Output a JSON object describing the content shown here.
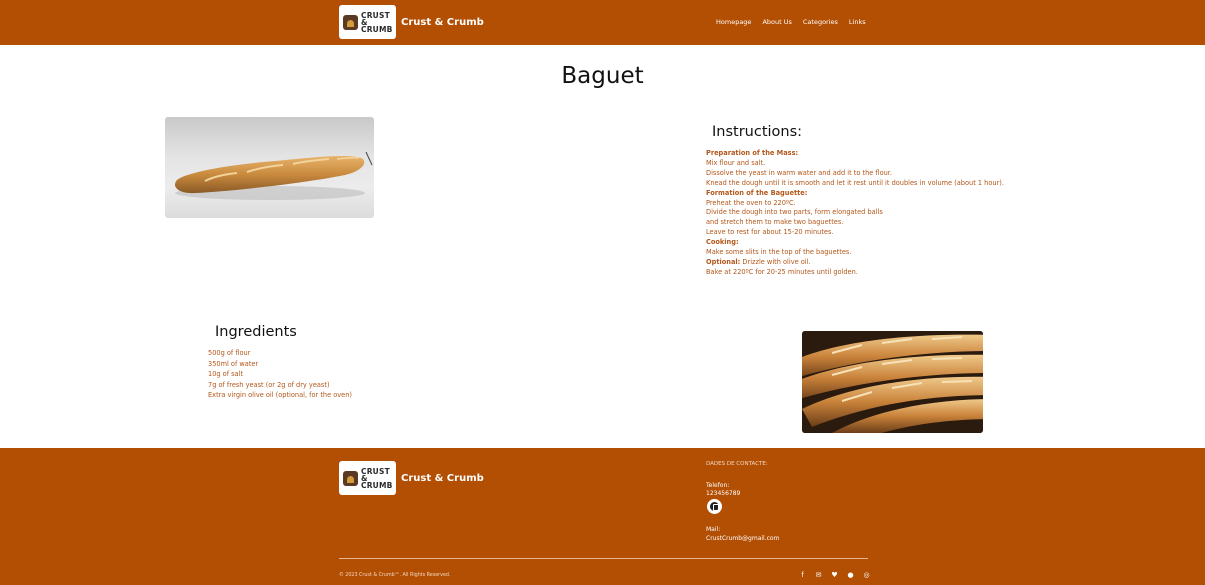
{
  "header": {
    "logo_text": [
      "CRUST",
      "&",
      "CRUMB"
    ],
    "brand": "Crust & Crumb",
    "nav": [
      "Homepage",
      "About Us",
      "Categories",
      "Links"
    ]
  },
  "page": {
    "title": "Baguet"
  },
  "instructions": {
    "title": "Instructions:",
    "s1_heading": "Preparation of the Mass:",
    "s1_l1": "Mix flour and salt.",
    "s1_l2": "Dissolve the yeast in warm water and add it to the flour.",
    "s1_l3": "Knead the dough until it is smooth and let it rest until it doubles in volume (about 1 hour).",
    "s2_heading": "Formation of the Baguette:",
    "s2_l1": "Preheat the oven to 220ºC.",
    "s2_l2": "Divide the dough into two parts, form elongated balls",
    "s2_l3": "and stretch them to make two baguettes.",
    "s2_l4": "Leave to rest for about 15-20 minutes.",
    "s3_heading": "Cooking:",
    "s3_l1": "Make some slits in the top of the baguettes.",
    "s3_optional_label": "Optional:",
    "s3_optional_text": " Drizzle with olive oil.",
    "s3_l2": "Bake at 220ºC for 20-25 minutes until golden."
  },
  "ingredients": {
    "title": "Ingredients",
    "items": [
      "500g of flour",
      "350ml of water",
      "10g of salt",
      "7g of fresh yeast (or 2g of dry yeast)",
      "Extra virgin olive oil (optional, for the oven)"
    ]
  },
  "footer": {
    "brand": "Crust & Crumb",
    "contact_heading": "DADES DE CONTACTE:",
    "phone_label": "Telefon:",
    "phone_value": "123456789",
    "mail_label": "Mail:",
    "mail_value": "CrustCrumb@gmail.com",
    "copyright": "© 2023 Crust & Crumb™. All Rights Reserved.",
    "social_icons": [
      "facebook-icon",
      "email-icon",
      "twitter-icon",
      "github-icon",
      "dribbble-icon"
    ]
  },
  "colors": {
    "brand_orange": "#b34f03",
    "text_orange": "#b3571a"
  }
}
